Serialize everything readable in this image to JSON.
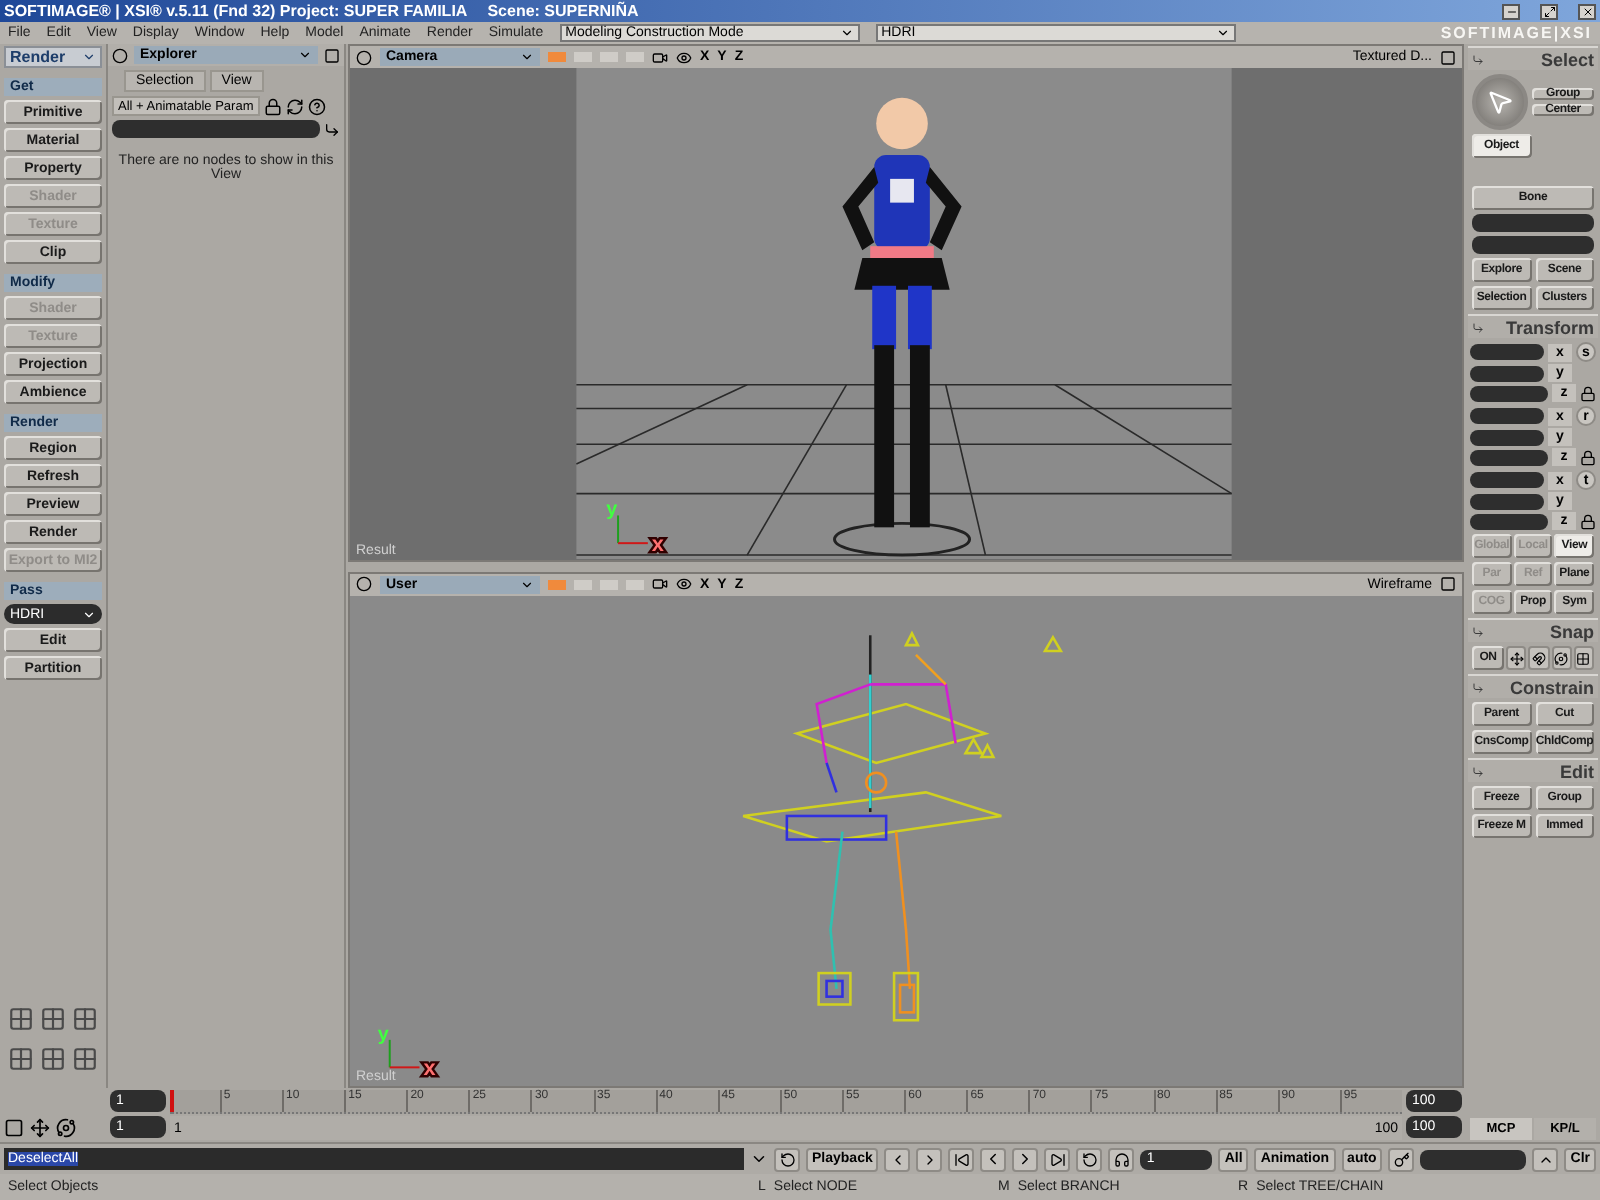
{
  "window": {
    "title": "SOFTIMAGE® | XSI® v.5.11 (Fnd 32) Project: SUPER FAMILIA",
    "scene": "Scene: SUPERNIÑA"
  },
  "menu": [
    "File",
    "Edit",
    "View",
    "Display",
    "Window",
    "Help",
    "Model",
    "Animate",
    "Render",
    "Simulate"
  ],
  "mode_selector": "Modeling Construction Mode",
  "pass_selector": "HDRI",
  "logo": "SOFTIMAGE|XSI",
  "left_panel": {
    "toolbar": "Render",
    "sections": [
      {
        "title": "Get",
        "items": [
          {
            "kind": "button",
            "label": "Primitive",
            "disabled": false
          },
          {
            "kind": "button",
            "label": "Material",
            "disabled": false
          },
          {
            "kind": "button",
            "label": "Property",
            "disabled": false
          },
          {
            "kind": "button",
            "label": "Shader",
            "disabled": true
          },
          {
            "kind": "button",
            "label": "Texture",
            "disabled": true
          },
          {
            "kind": "button",
            "label": "Clip",
            "disabled": false
          }
        ]
      },
      {
        "title": "Modify",
        "items": [
          {
            "kind": "button",
            "label": "Shader",
            "disabled": true
          },
          {
            "kind": "button",
            "label": "Texture",
            "disabled": true
          },
          {
            "kind": "button",
            "label": "Projection",
            "disabled": false
          },
          {
            "kind": "button",
            "label": "Ambience",
            "disabled": false
          }
        ]
      },
      {
        "title": "Render",
        "items": [
          {
            "kind": "button",
            "label": "Region",
            "disabled": false
          },
          {
            "kind": "button",
            "label": "Refresh",
            "disabled": false
          },
          {
            "kind": "button",
            "label": "Preview",
            "disabled": false
          },
          {
            "kind": "button",
            "label": "Render",
            "disabled": false
          },
          {
            "kind": "button",
            "label": "Export to MI2",
            "disabled": true
          }
        ]
      },
      {
        "title": "Pass",
        "items": [
          {
            "kind": "dropdown",
            "label": "HDRI",
            "disabled": false
          },
          {
            "kind": "button",
            "label": "Edit",
            "disabled": false
          },
          {
            "kind": "button",
            "label": "Partition",
            "disabled": false
          }
        ]
      }
    ]
  },
  "explorer": {
    "title": "Explorer",
    "tabs": [
      "Selection",
      "View"
    ],
    "filter": "All + Animatable Param",
    "message": "There are no nodes to show in this View"
  },
  "viewports": [
    {
      "kind": "camera",
      "camera": "Camera",
      "toggles": [
        {
          "on": true
        },
        {
          "on": false
        },
        {
          "on": false
        },
        {
          "on": false
        }
      ],
      "axes": [
        "X",
        "Y",
        "Z"
      ],
      "display_mode": "Textured D...",
      "gizmo": [
        "y",
        "x"
      ],
      "label": "Result"
    },
    {
      "kind": "skeleton",
      "camera": "User",
      "toggles": [
        {
          "on": true
        },
        {
          "on": false
        },
        {
          "on": false
        },
        {
          "on": false
        }
      ],
      "axes": [
        "X",
        "Y",
        "Z"
      ],
      "display_mode": "Wireframe",
      "gizmo": [
        "y",
        "x"
      ],
      "label": "Result"
    }
  ],
  "right_panel": {
    "select": {
      "title": "Select",
      "buttons": [
        "Group",
        "Center"
      ],
      "filters": [
        {
          "label": "Object",
          "selected": true
        }
      ],
      "bone": "Bone",
      "buttons_2": [
        "Explore",
        "Scene",
        "Selection",
        "Clusters"
      ]
    },
    "transform": {
      "title": "Transform",
      "groups": [
        {
          "label": "s",
          "axes": [
            "x",
            "y",
            "z"
          ]
        },
        {
          "label": "r",
          "axes": [
            "x",
            "y",
            "z"
          ]
        },
        {
          "label": "t",
          "axes": [
            "x",
            "y",
            "z"
          ]
        }
      ],
      "options": [
        [
          {
            "label": "Global",
            "disabled": true,
            "selected": false
          },
          {
            "label": "Local",
            "disabled": true,
            "selected": false
          },
          {
            "label": "View",
            "disabled": false,
            "selected": true
          }
        ],
        [
          {
            "label": "Par",
            "disabled": true,
            "selected": false
          },
          {
            "label": "Ref",
            "disabled": true,
            "selected": false
          },
          {
            "label": "Plane",
            "disabled": false,
            "selected": false
          }
        ],
        [
          {
            "label": "COG",
            "disabled": true,
            "selected": false
          },
          {
            "label": "Prop",
            "disabled": false,
            "selected": false
          },
          {
            "label": "Sym",
            "disabled": false,
            "selected": false
          }
        ]
      ]
    },
    "snap": {
      "title": "Snap",
      "on": "ON"
    },
    "constrain": {
      "title": "Constrain",
      "buttons": [
        "Parent",
        "Cut",
        "CnsComp",
        "ChldComp"
      ]
    },
    "edit": {
      "title": "Edit",
      "buttons": [
        "Freeze",
        "Group",
        "Freeze M",
        "Immed"
      ]
    },
    "tabs": [
      {
        "label": "MCP",
        "selected": true
      },
      {
        "label": "KP/L",
        "selected": false
      }
    ]
  },
  "timeline": {
    "current_frame": "1",
    "ticks": [
      "5",
      "10",
      "15",
      "20",
      "25",
      "30",
      "35",
      "40",
      "45",
      "50",
      "55",
      "60",
      "65",
      "70",
      "75",
      "80",
      "85",
      "90",
      "95"
    ],
    "end_frame": "100",
    "range_start": "1",
    "range": {
      "level": 1,
      "label_start": "1",
      "label_end": "100"
    },
    "range_end": "100"
  },
  "command_bar": {
    "command": "DeselectAll",
    "playback": "Playback",
    "frame": "1",
    "all": "All",
    "animation": "Animation",
    "auto": "auto",
    "clear": "Clr"
  },
  "status_bar": {
    "message": "Select Objects",
    "hints": [
      {
        "key": "L",
        "text": "Select NODE"
      },
      {
        "key": "M",
        "text": "Select BRANCH"
      },
      {
        "key": "R",
        "text": "Select TREE/CHAIN"
      }
    ]
  }
}
